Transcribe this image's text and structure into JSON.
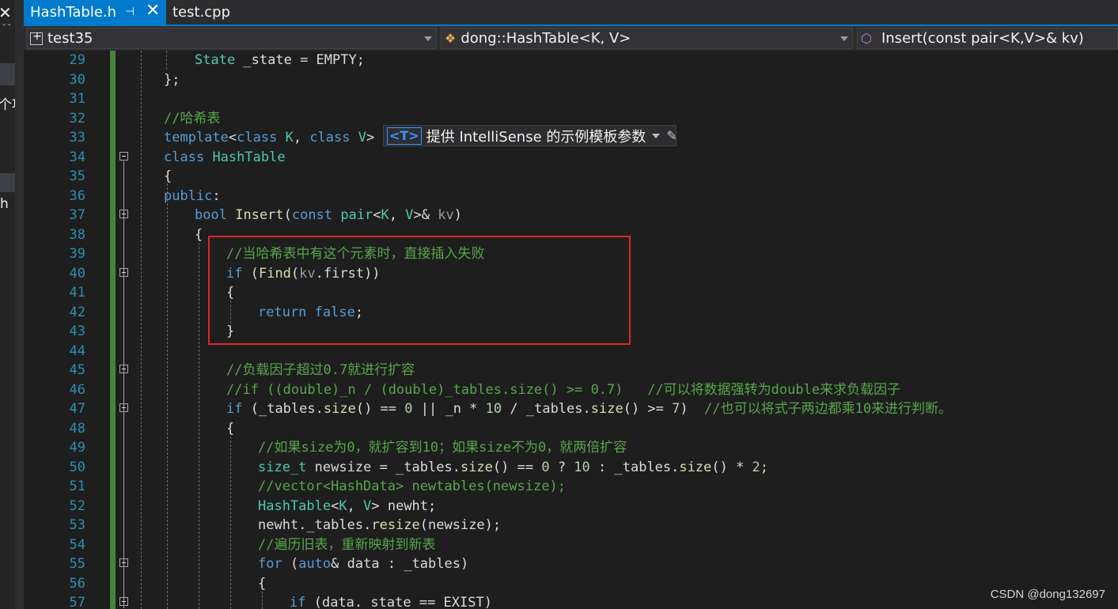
{
  "left_panel": {
    "close_glyph": "✕",
    "chars": [
      "ˇˇ",
      "个项",
      "h"
    ]
  },
  "tabs": [
    {
      "label": "HashTable.h",
      "pin": "⊣",
      "close": "✕"
    },
    {
      "label": "test.cpp"
    }
  ],
  "nav": {
    "project": "test35",
    "scope": "dong::HashTable<K, V>",
    "member": "Insert(const pair<K,V>& kv)"
  },
  "intellisense_hint": {
    "badge": "<T>",
    "text": "提供 IntelliSense 的示例模板参数"
  },
  "code_lines": [
    {
      "n": "29",
      "text": "State _state = EMPTY;"
    },
    {
      "n": "30",
      "text": "};"
    },
    {
      "n": "31",
      "text": ""
    },
    {
      "n": "32",
      "text": "//哈希表"
    },
    {
      "n": "33",
      "text": "template<class K, class V>"
    },
    {
      "n": "34",
      "text": "class HashTable"
    },
    {
      "n": "35",
      "text": "{"
    },
    {
      "n": "36",
      "text": "public:"
    },
    {
      "n": "37",
      "text": "bool Insert(const pair<K, V>& kv)"
    },
    {
      "n": "38",
      "text": "{"
    },
    {
      "n": "39",
      "text": "//当哈希表中有这个元素时，直接插入失败"
    },
    {
      "n": "40",
      "text": "if (Find(kv.first))"
    },
    {
      "n": "41",
      "text": "{"
    },
    {
      "n": "42",
      "text": "return false;"
    },
    {
      "n": "43",
      "text": "}"
    },
    {
      "n": "44",
      "text": ""
    },
    {
      "n": "45",
      "text": "//负载因子超过0.7就进行扩容"
    },
    {
      "n": "46",
      "text": "//if ((double)_n / (double)_tables.size() >= 0.7)   //可以将数据强转为double来求负载因子"
    },
    {
      "n": "47",
      "text": "if (_tables.size() == 0 || _n * 10 / _tables.size() >= 7)  //也可以将式子两边都乘10来进行判断。"
    },
    {
      "n": "48",
      "text": "{"
    },
    {
      "n": "49",
      "text": "//如果size为0，就扩容到10；如果size不为0，就两倍扩容"
    },
    {
      "n": "50",
      "text": "size_t newsize = _tables.size() == 0 ? 10 : _tables.size() * 2;"
    },
    {
      "n": "51",
      "text": "//vector<HashData> newtables(newsize);"
    },
    {
      "n": "52",
      "text": "HashTable<K, V> newht;"
    },
    {
      "n": "53",
      "text": "newht._tables.resize(newsize);"
    },
    {
      "n": "54",
      "text": "//遍历旧表，重新映射到新表"
    },
    {
      "n": "55",
      "text": "for (auto& data : _tables)"
    },
    {
      "n": "56",
      "text": "{"
    },
    {
      "n": "57",
      "text": "if (data._state == EXIST)"
    }
  ],
  "watermark": "CSDN @dong132697"
}
